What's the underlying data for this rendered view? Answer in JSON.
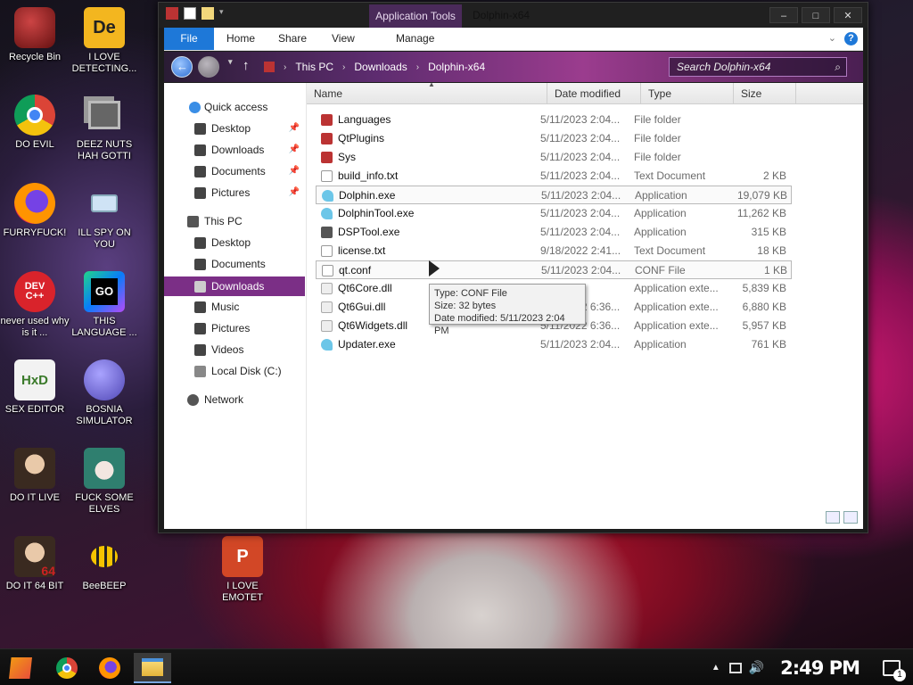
{
  "desktop": {
    "icons": [
      {
        "label": "Recycle Bin"
      },
      {
        "label": "I LOVE DETECTING..."
      },
      {
        "label": "DO EVIL"
      },
      {
        "label": "DEEZ NUTS HAH GOTTI"
      },
      {
        "label": "FURRYFUCK!"
      },
      {
        "label": "ILL SPY ON YOU"
      },
      {
        "label": "never used why is it ..."
      },
      {
        "label": "THIS LANGUAGE ..."
      },
      {
        "label": "SEX EDITOR"
      },
      {
        "label": "BOSNIA SIMULATOR"
      },
      {
        "label": "DO IT LIVE"
      },
      {
        "label": "FUCK SOME ELVES"
      },
      {
        "label": "DO IT 64 BIT"
      },
      {
        "label": "BeeBEEP"
      },
      {
        "label": "I LOVE EMOTET"
      }
    ],
    "icon_glyphs": [
      "De",
      "DEV C++",
      "GO",
      "HxD",
      "64"
    ]
  },
  "window": {
    "title": "Dolphin-x64",
    "context_tab": "Application Tools",
    "buttons": {
      "minimize": "–",
      "maximize": "□",
      "close": "✕"
    }
  },
  "ribbon": {
    "tabs": [
      "File",
      "Home",
      "Share",
      "View",
      "Manage"
    ],
    "help": "?"
  },
  "address": {
    "breadcrumbs": [
      "This PC",
      "Downloads",
      "Dolphin-x64"
    ],
    "search_placeholder": "Search Dolphin-x64"
  },
  "nav_pane": {
    "items": [
      {
        "label": "Quick access"
      },
      {
        "label": "Desktop"
      },
      {
        "label": "Downloads"
      },
      {
        "label": "Documents"
      },
      {
        "label": "Pictures"
      },
      {
        "label": "This PC"
      },
      {
        "label": "Desktop"
      },
      {
        "label": "Documents"
      },
      {
        "label": "Downloads"
      },
      {
        "label": "Music"
      },
      {
        "label": "Pictures"
      },
      {
        "label": "Videos"
      },
      {
        "label": "Local Disk (C:)"
      },
      {
        "label": "Network"
      }
    ]
  },
  "files": {
    "columns": [
      "Name",
      "Date modified",
      "Type",
      "Size"
    ],
    "rows": [
      {
        "name": "Languages",
        "date": "5/11/2023 2:04...",
        "type": "File folder",
        "size": ""
      },
      {
        "name": "QtPlugins",
        "date": "5/11/2023 2:04...",
        "type": "File folder",
        "size": ""
      },
      {
        "name": "Sys",
        "date": "5/11/2023 2:04...",
        "type": "File folder",
        "size": ""
      },
      {
        "name": "build_info.txt",
        "date": "5/11/2023 2:04...",
        "type": "Text Document",
        "size": "2 KB"
      },
      {
        "name": "Dolphin.exe",
        "date": "5/11/2023 2:04...",
        "type": "Application",
        "size": "19,079 KB"
      },
      {
        "name": "DolphinTool.exe",
        "date": "5/11/2023 2:04...",
        "type": "Application",
        "size": "11,262 KB"
      },
      {
        "name": "DSPTool.exe",
        "date": "5/11/2023 2:04...",
        "type": "Application",
        "size": "315 KB"
      },
      {
        "name": "license.txt",
        "date": "9/18/2022 2:41...",
        "type": "Text Document",
        "size": "18 KB"
      },
      {
        "name": "qt.conf",
        "date": "5/11/2023 2:04...",
        "type": "CONF File",
        "size": "1 KB"
      },
      {
        "name": "Qt6Core.dll",
        "date": "",
        "type": "Application exte...",
        "size": "5,839 KB"
      },
      {
        "name": "Qt6Gui.dll",
        "date": "5/11/2022 6:36...",
        "type": "Application exte...",
        "size": "6,880 KB"
      },
      {
        "name": "Qt6Widgets.dll",
        "date": "5/11/2022 6:36...",
        "type": "Application exte...",
        "size": "5,957 KB"
      },
      {
        "name": "Updater.exe",
        "date": "5/11/2023 2:04...",
        "type": "Application",
        "size": "761 KB"
      }
    ]
  },
  "tooltip": {
    "type": "Type: CONF File",
    "size": "Size: 32 bytes",
    "date": "Date modified: 5/11/2023 2:04 PM"
  },
  "taskbar": {
    "clock": "2:49 PM",
    "notification_count": "1"
  }
}
